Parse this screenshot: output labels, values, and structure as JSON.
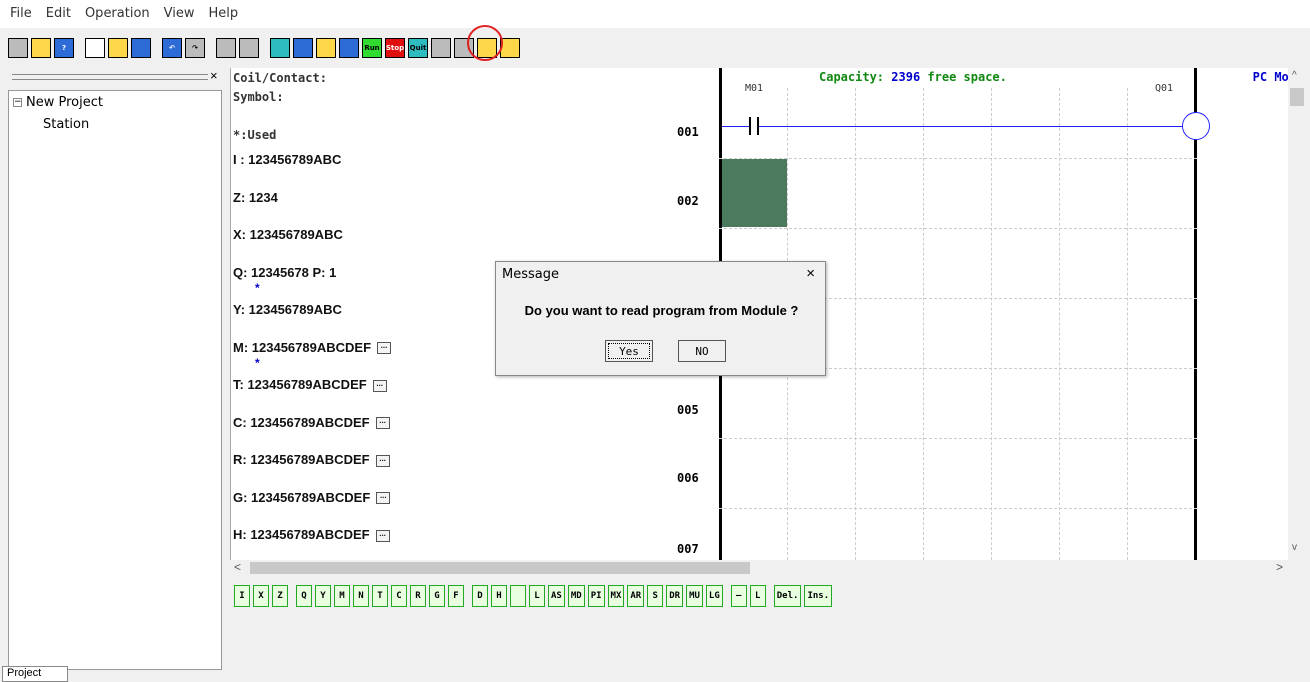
{
  "menu": [
    "File",
    "Edit",
    "Operation",
    "View",
    "Help"
  ],
  "toolbar": [
    {
      "icon": "select-icon",
      "cls": "gray",
      "label": ""
    },
    {
      "icon": "open-folder-icon",
      "cls": "yellow",
      "label": ""
    },
    {
      "icon": "help-icon",
      "cls": "blue",
      "label": "?"
    },
    {
      "icon": "new-file-icon",
      "cls": "white",
      "label": ""
    },
    {
      "icon": "open-icon",
      "cls": "yellow",
      "label": ""
    },
    {
      "icon": "save-icon",
      "cls": "blue",
      "label": ""
    },
    {
      "icon": "undo-icon",
      "cls": "blue",
      "label": "↶"
    },
    {
      "icon": "redo-icon",
      "cls": "gray",
      "label": "↷"
    },
    {
      "icon": "ladder-icon",
      "cls": "gray",
      "label": ""
    },
    {
      "icon": "fbd-icon",
      "cls": "gray",
      "label": ""
    },
    {
      "icon": "monitor-icon",
      "cls": "teal",
      "label": ""
    },
    {
      "icon": "connect-icon",
      "cls": "blue",
      "label": ""
    },
    {
      "icon": "transfer-icon",
      "cls": "yellow",
      "label": ""
    },
    {
      "icon": "tools-icon",
      "cls": "blue",
      "label": ""
    },
    {
      "icon": "run-icon",
      "cls": "green",
      "label": "Run"
    },
    {
      "icon": "stop-icon",
      "cls": "red",
      "label": "Stop"
    },
    {
      "icon": "quit-icon",
      "cls": "teal",
      "label": "Quit"
    },
    {
      "icon": "simulate-icon",
      "cls": "gray",
      "label": ""
    },
    {
      "icon": "pen-icon",
      "cls": "gray",
      "label": ""
    },
    {
      "icon": "read-icon",
      "cls": "yellow",
      "label": ""
    },
    {
      "icon": "write-icon",
      "cls": "yellow",
      "label": ""
    }
  ],
  "tree": {
    "root": "New Project",
    "child": "Station",
    "tab": "Project"
  },
  "info": {
    "coil_label": "Coil/Contact:",
    "symbol_label": "Symbol:",
    "used_label": "*:Used",
    "regs": [
      {
        "text": "I : 123456789ABC",
        "dots": false,
        "star": false
      },
      {
        "text": "Z: 1234",
        "dots": false,
        "star": false
      },
      {
        "text": "X: 123456789ABC",
        "dots": false,
        "star": false
      },
      {
        "text": "Q: 12345678   P: 1",
        "dots": false,
        "star": true
      },
      {
        "text": "Y: 123456789ABC",
        "dots": false,
        "star": false
      },
      {
        "text": "M: 123456789ABCDEF",
        "dots": true,
        "star": true
      },
      {
        "text": "T: 123456789ABCDEF",
        "dots": true,
        "star": false
      },
      {
        "text": "C: 123456789ABCDEF",
        "dots": true,
        "star": false
      },
      {
        "text": "R: 123456789ABCDEF",
        "dots": true,
        "star": false
      },
      {
        "text": "G: 123456789ABCDEF",
        "dots": true,
        "star": false
      },
      {
        "text": "H: 123456789ABCDEF",
        "dots": true,
        "star": false
      }
    ],
    "star": "*",
    "dots": "..."
  },
  "capacity": {
    "prefix": "Capacity:",
    "value": "2396",
    "suffix": "free space."
  },
  "mode": "PC Mod",
  "rows": [
    "001",
    "002",
    "005",
    "006",
    "007"
  ],
  "ladder": {
    "contact": "M01",
    "coil": "Q01"
  },
  "bottom_buttons": [
    "I",
    "X",
    "Z",
    "Q",
    "Y",
    "M",
    "N",
    "T",
    "C",
    "R",
    "G",
    "F",
    "D",
    "H",
    "",
    "L",
    "AS",
    "MD",
    "PI",
    "MX",
    "AR",
    "S",
    "DR",
    "MU",
    "LG",
    "—",
    "L",
    "Del.",
    "Ins."
  ],
  "dialog": {
    "title": "Message",
    "close": "×",
    "message": "Do you want to read program from Module ?",
    "yes": "Yes",
    "no": "NO"
  },
  "scroll": {
    "left": "<",
    "right": ">",
    "up": "^",
    "down": "v"
  }
}
